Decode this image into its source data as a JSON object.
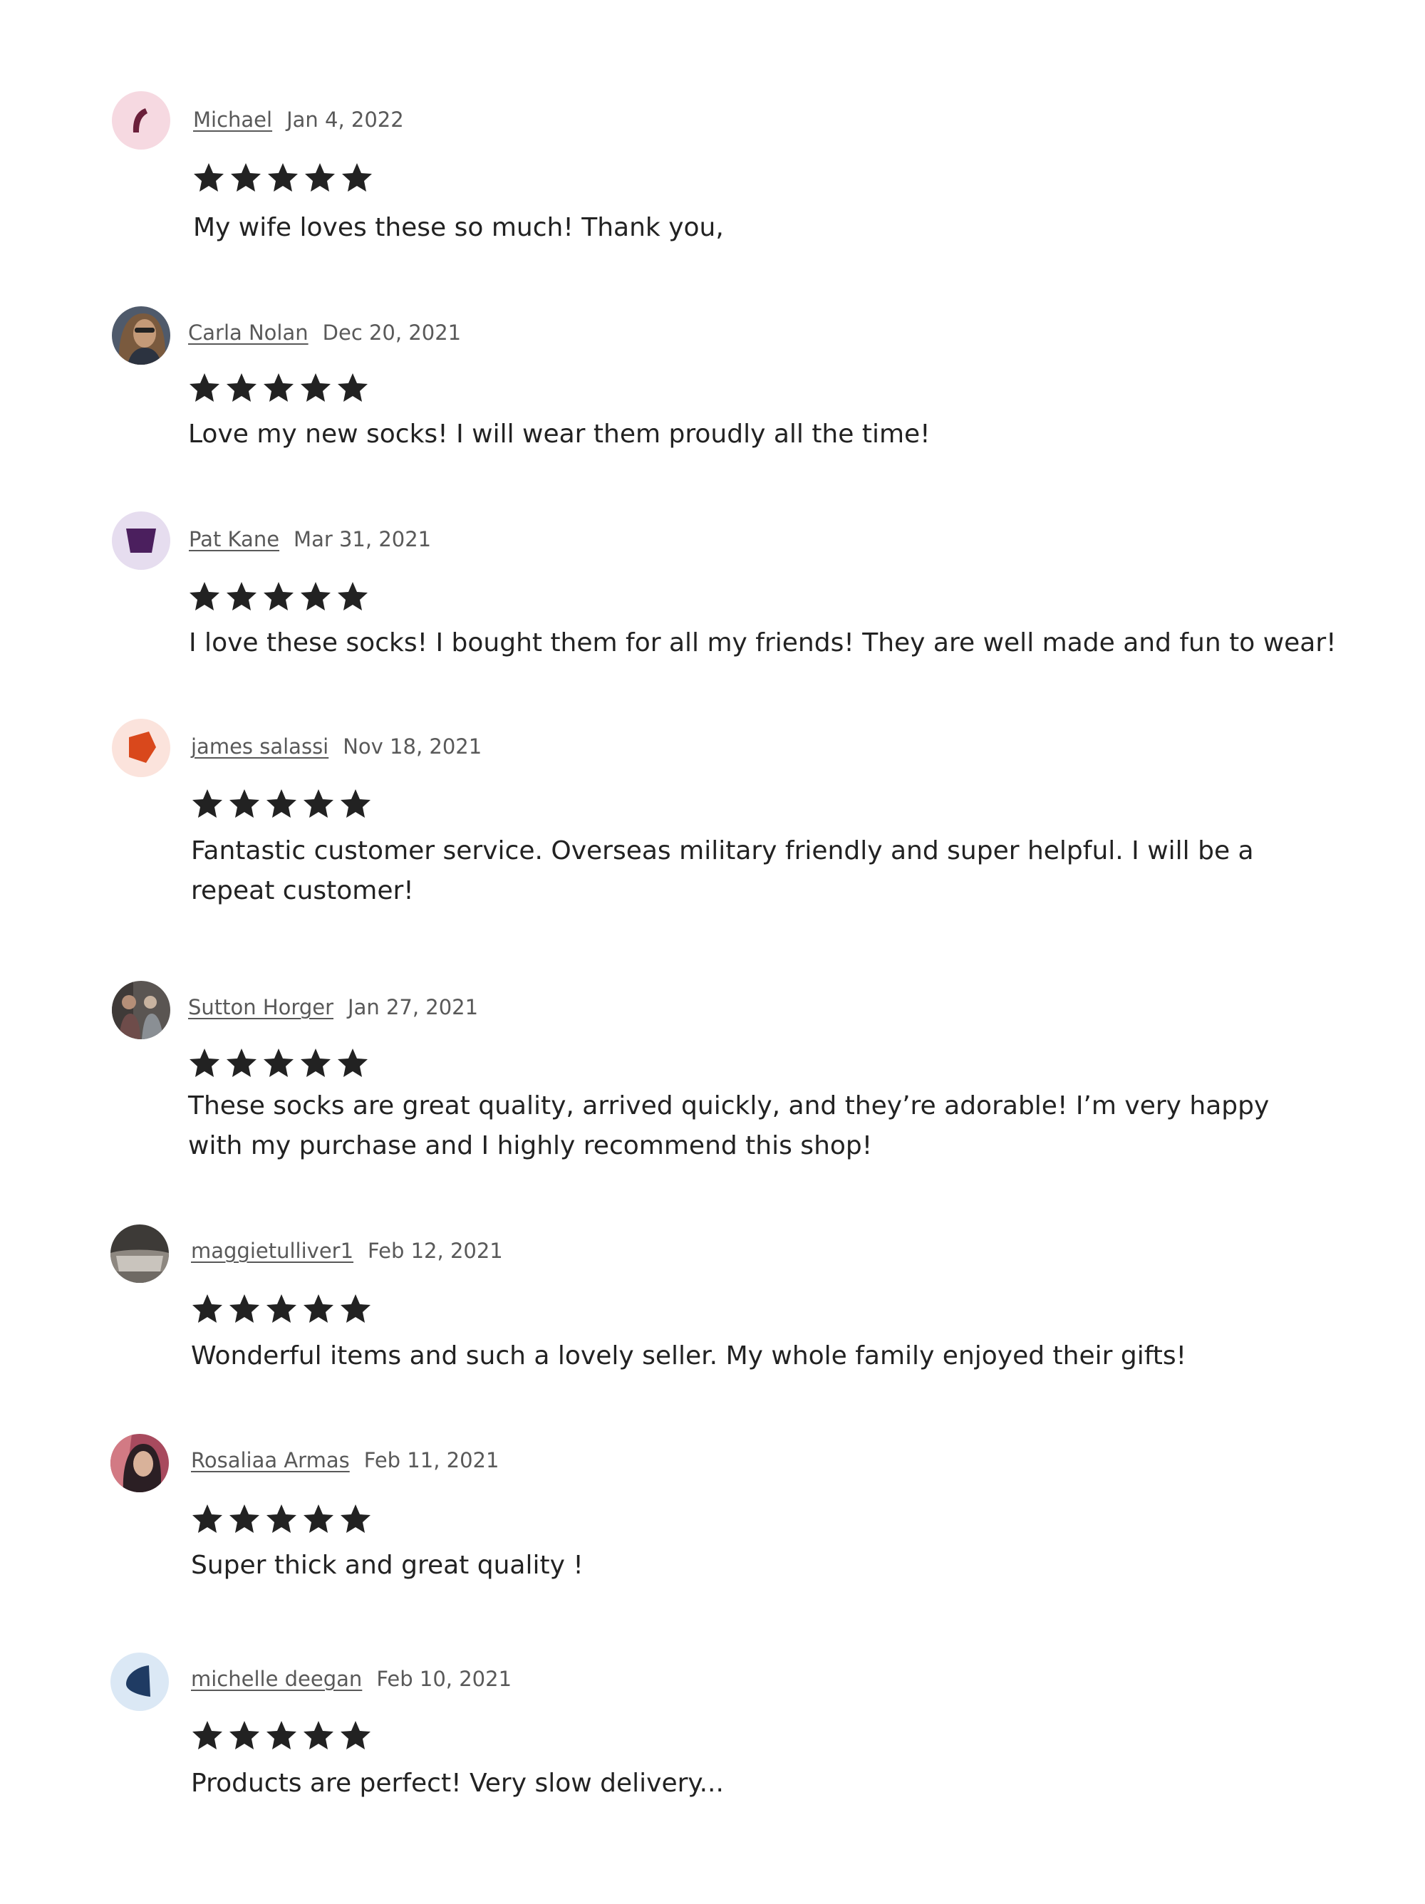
{
  "reviews": [
    {
      "name": "Michael",
      "date": "Jan 4, 2022",
      "rating": 5,
      "text": "My wife loves these so much! Thank you,",
      "avatar_icon": "abstract-shape-avatar-icon",
      "avatar_bg": "#f6d9e1",
      "avatar_color": "#6b1f3a"
    },
    {
      "name": "Carla Nolan",
      "date": "Dec 20, 2021",
      "rating": 5,
      "text": "Love my new socks! I will wear them proudly all the time!",
      "avatar_icon": "user-photo-avatar",
      "avatar_bg": "#4f5a6b",
      "avatar_color": "#b08a6a"
    },
    {
      "name": "Pat Kane",
      "date": "Mar 31, 2021",
      "rating": 5,
      "text": "I love these socks! I bought them for all my friends! They are well made and fun to wear!",
      "avatar_icon": "abstract-shape-avatar-icon",
      "avatar_bg": "#e6ddef",
      "avatar_color": "#4b1f5e"
    },
    {
      "name": "james salassi",
      "date": "Nov 18, 2021",
      "rating": 5,
      "text": "Fantastic customer service. Overseas military friendly and super helpful. I will be a repeat customer!",
      "avatar_icon": "abstract-shape-avatar-icon",
      "avatar_bg": "#fbe3dc",
      "avatar_color": "#d9481c"
    },
    {
      "name": "Sutton Horger",
      "date": "Jan 27, 2021",
      "rating": 5,
      "text": "These socks are great quality, arrived quickly, and they’re adorable! I’m very happy with my purchase and I highly recommend this shop!",
      "avatar_icon": "user-photo-avatar",
      "avatar_bg": "#5a5552",
      "avatar_color": "#8a8f94"
    },
    {
      "name": "maggietulliver1",
      "date": "Feb 12, 2021",
      "rating": 5,
      "text": "Wonderful items and such a lovely seller. My whole family enjoyed their gifts!",
      "avatar_icon": "user-photo-avatar",
      "avatar_bg": "#3d3a37",
      "avatar_color": "#c9c4bd"
    },
    {
      "name": "Rosaliaa Armas",
      "date": "Feb 11, 2021",
      "rating": 5,
      "text": "Super thick and great quality !",
      "avatar_icon": "user-photo-avatar",
      "avatar_bg": "#a84a5e",
      "avatar_color": "#2b1f24"
    },
    {
      "name": "michelle deegan",
      "date": "Feb 10, 2021",
      "rating": 5,
      "text": "Products are perfect! Very slow delivery...",
      "avatar_icon": "abstract-shape-avatar-icon",
      "avatar_bg": "#dbe8f5",
      "avatar_color": "#1f3b63"
    }
  ],
  "colors": {
    "star": "#222222",
    "name": "#595959",
    "date": "#595959",
    "text": "#222222"
  }
}
